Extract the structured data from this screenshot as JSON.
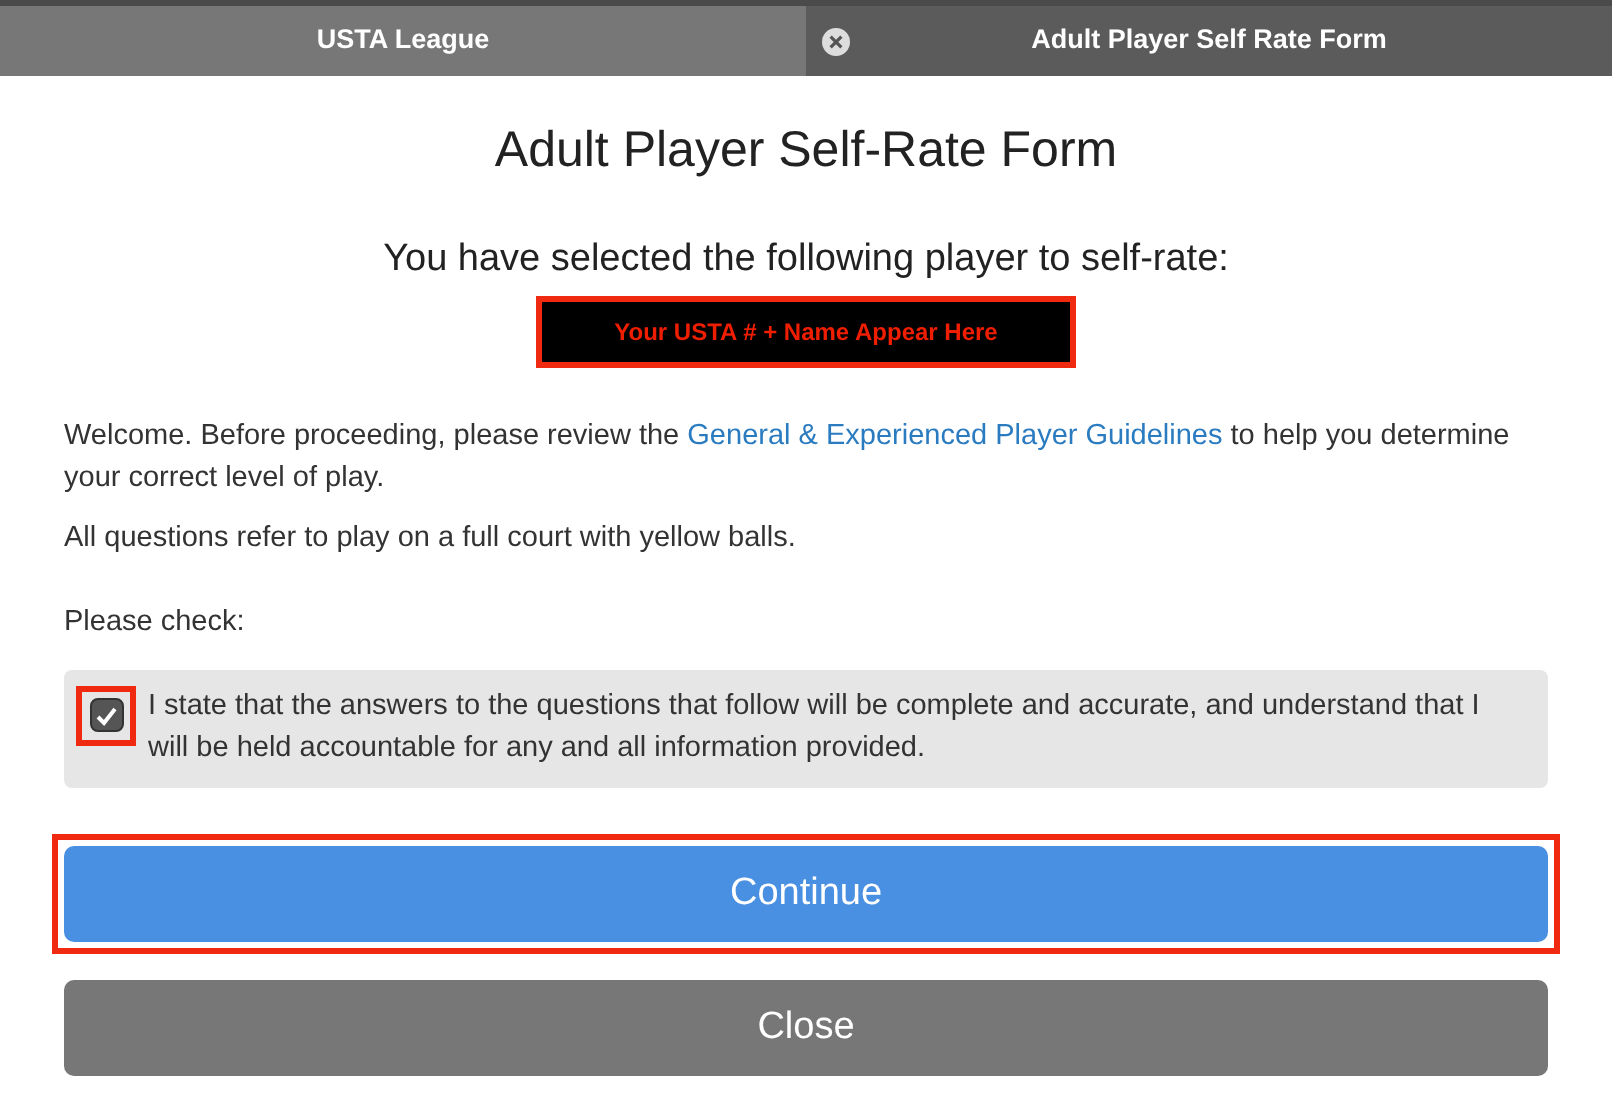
{
  "tabs": [
    {
      "label": "USTA League",
      "selected": false,
      "closable": false
    },
    {
      "label": "Adult Player Self Rate Form",
      "selected": true,
      "closable": true
    }
  ],
  "title": "Adult Player Self-Rate Form",
  "subtitle": "You have selected the following player to self-rate:",
  "player_field": {
    "text": "Your USTA # + Name Appear Here",
    "highlighted": true
  },
  "intro": {
    "before": "Welcome. Before proceeding, please review the ",
    "link": "General & Experienced Player Guidelines",
    "after": " to help you determine your correct level of play."
  },
  "note": "All questions refer to play on a full court with yellow balls.",
  "check_label": "Please check:",
  "agreement": {
    "text": "I state that the answers to the questions that follow will be complete and accurate, and understand that I will be held accountable for any and all information provided.",
    "checked": true,
    "highlighted": true
  },
  "buttons": [
    {
      "label": "Continue",
      "kind": "primary",
      "highlighted": true
    },
    {
      "label": "Close",
      "kind": "secondary",
      "highlighted": false
    }
  ]
}
